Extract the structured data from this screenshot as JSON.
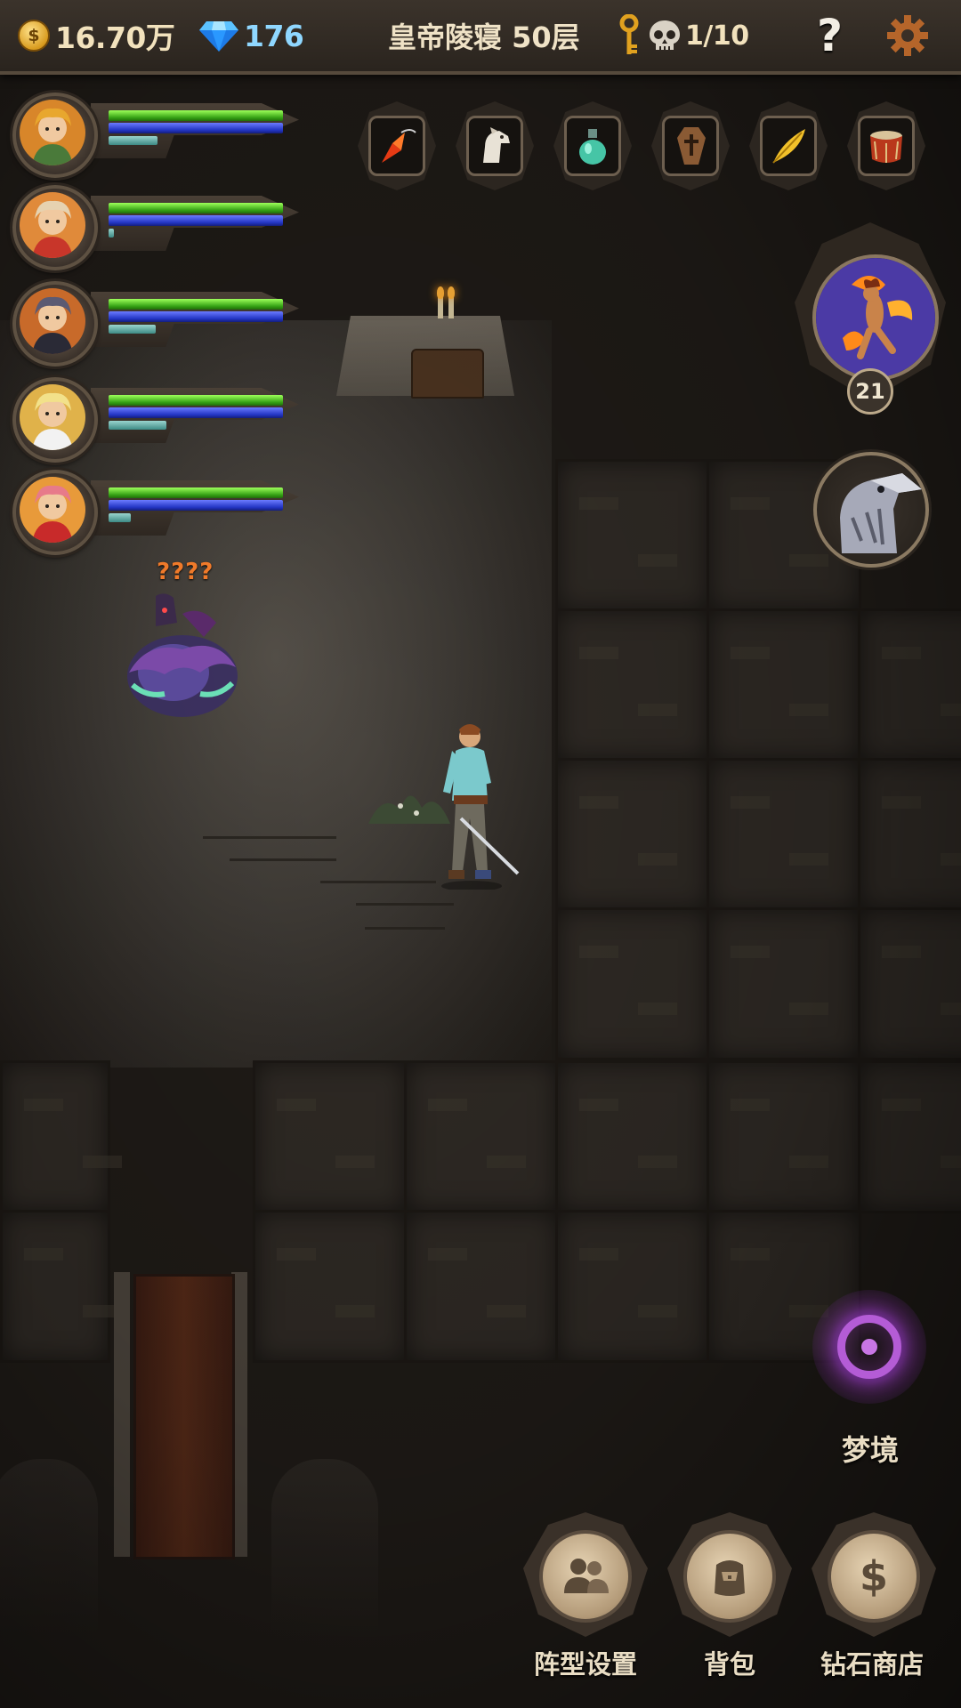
{
  "top_bar": {
    "gold_icon": "gold-coin-icon",
    "gold_value": "16.70万",
    "gem_icon": "diamond-icon",
    "gem_value": "176",
    "floor_title": "皇帝陵寝 50层",
    "key_icon": "key-icon",
    "skull_icon": "skull-icon",
    "kill_count": "1/10",
    "help_label": "?",
    "settings_icon": "gear-icon"
  },
  "heroes": [
    {
      "name": "hero-1",
      "hp": 1.0,
      "mp": 1.0,
      "xp": 0.28
    },
    {
      "name": "hero-2",
      "hp": 1.0,
      "mp": 1.0,
      "xp": 0.0
    },
    {
      "name": "hero-3",
      "hp": 1.0,
      "mp": 1.0,
      "xp": 0.27
    },
    {
      "name": "hero-4",
      "hp": 1.0,
      "mp": 1.0,
      "xp": 0.33
    },
    {
      "name": "hero-5",
      "hp": 1.0,
      "mp": 1.0,
      "xp": 0.13
    }
  ],
  "relics": [
    "carrot-dagger-icon",
    "horse-head-icon",
    "potion-flask-icon",
    "coffin-icon",
    "golden-feather-icon",
    "drum-icon"
  ],
  "boss": {
    "icon": "fire-dancer-portrait",
    "level": "21"
  },
  "raven_icon": "raven-head-icon",
  "enemy": {
    "label": "????"
  },
  "dream": {
    "label": "梦境",
    "icon": "portal-ring-icon"
  },
  "bottom_buttons": [
    {
      "id": "formation",
      "label": "阵型设置",
      "icon": "party-icon"
    },
    {
      "id": "backpack",
      "label": "背包",
      "icon": "backpack-icon"
    },
    {
      "id": "diamond-shop",
      "label": "钻石商店",
      "icon": "dollar-icon"
    }
  ],
  "colors": {
    "hp": "#34a014",
    "mp": "#2234c2",
    "xp": "#3d8a84",
    "enemy_label": "#f07a2a",
    "gem_text": "#8fd7ff",
    "dream_purple": "#b45cd6"
  }
}
